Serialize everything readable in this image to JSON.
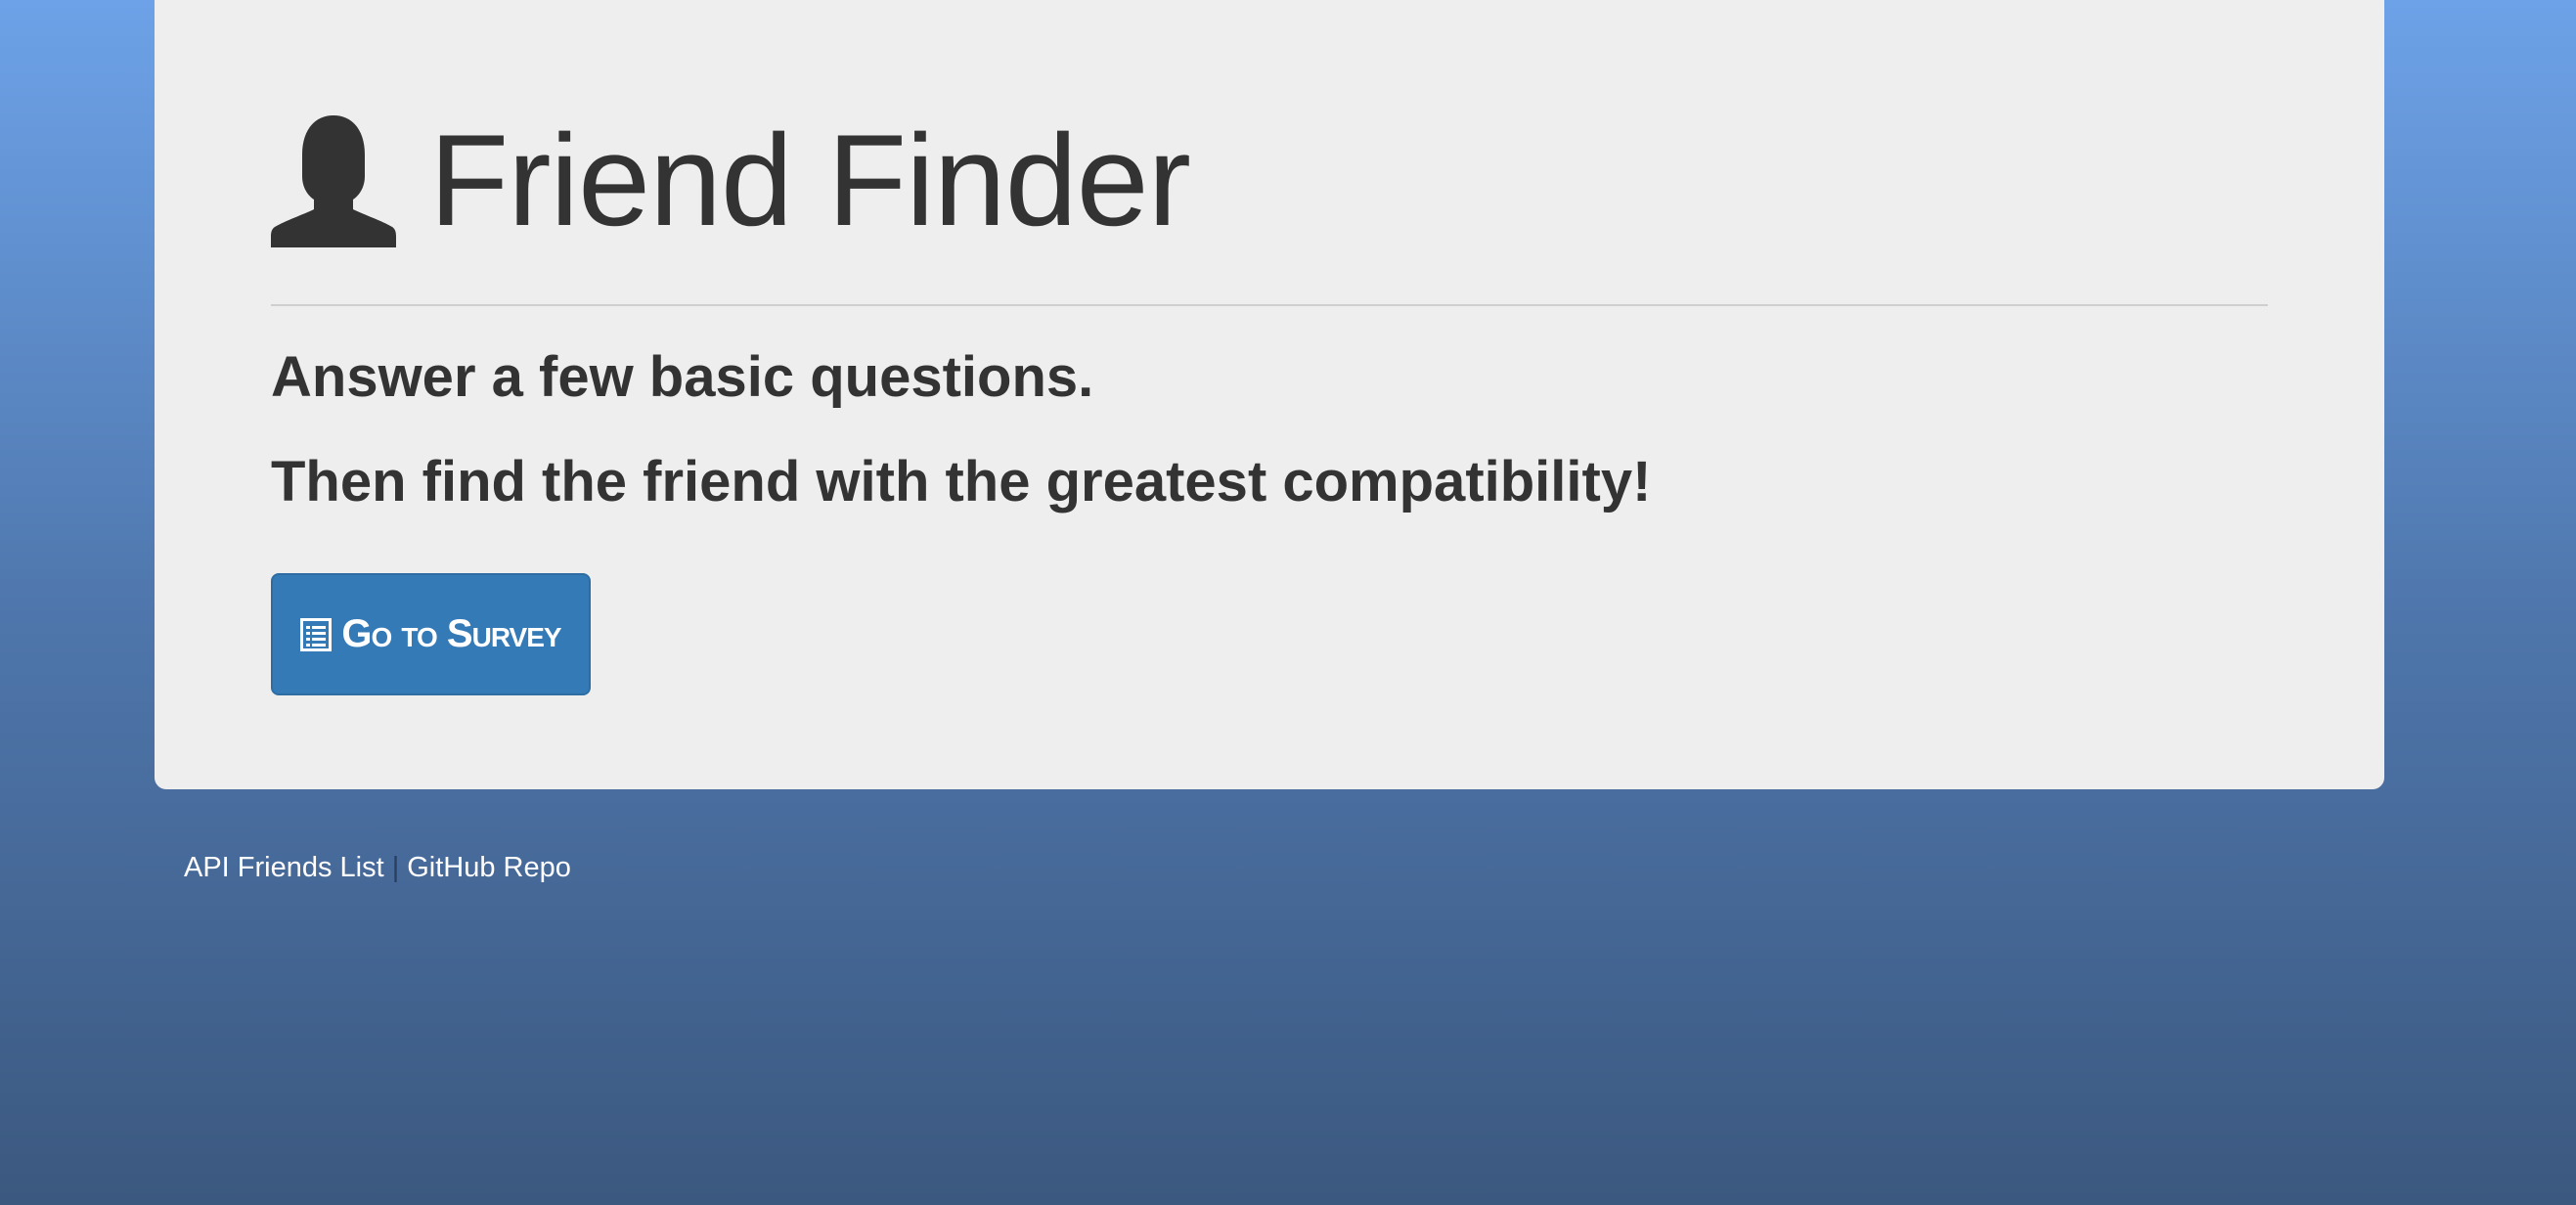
{
  "header": {
    "title": "Friend Finder",
    "icon": "user-icon"
  },
  "intro": {
    "line1": "Answer a few basic questions.",
    "line2": "Then find the friend with the greatest compatibility!"
  },
  "survey_button": {
    "label": "Go to Survey",
    "icon": "list-icon",
    "color": "#337ab7"
  },
  "footer": {
    "link1": "API Friends List",
    "separator": "|",
    "link2": "GitHub Repo"
  }
}
